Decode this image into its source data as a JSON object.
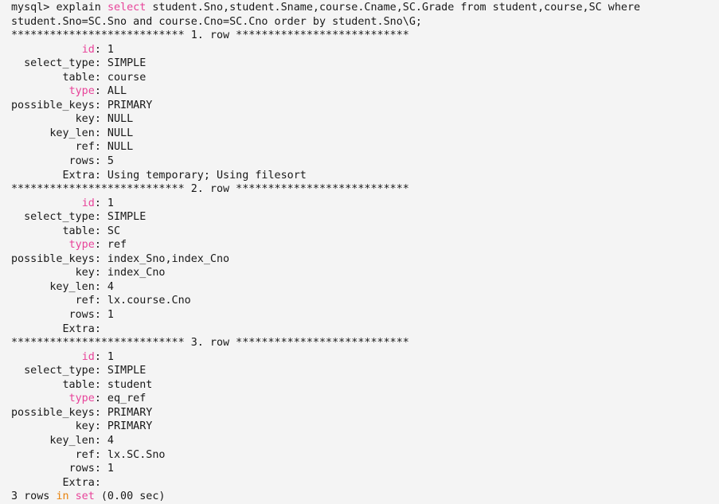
{
  "terminal": {
    "prompt": "mysql> ",
    "colors": {
      "background": "#f4f4f4",
      "foreground": "#181818",
      "keyword_pink": "#e8449a",
      "keyword_orange": "#e8820c"
    },
    "query": {
      "command": "explain ",
      "keyword_select": "select",
      "select_list": " student.Sno,student.Sname,course.Cname,SC.Grade from student,course,SC where",
      "continuation": "student.Sno=SC.Sno and course.Cno=SC.Cno order by student.Sno\\G;"
    },
    "separator": {
      "asterisks_left": "***************************",
      "asterisks_right": "***************************",
      "row_word": "row"
    },
    "rows": [
      {
        "index": "1.",
        "fields": [
          {
            "label": "id",
            "keyword": true,
            "value": "1"
          },
          {
            "label": "select_type",
            "keyword": false,
            "value": "SIMPLE"
          },
          {
            "label": "table",
            "keyword": false,
            "value": "course"
          },
          {
            "label": "type",
            "keyword": true,
            "value": "ALL"
          },
          {
            "label": "possible_keys",
            "keyword": false,
            "value": "PRIMARY"
          },
          {
            "label": "key",
            "keyword": false,
            "value": "NULL"
          },
          {
            "label": "key_len",
            "keyword": false,
            "value": "NULL"
          },
          {
            "label": "ref",
            "keyword": false,
            "value": "NULL"
          },
          {
            "label": "rows",
            "keyword": false,
            "value": "5"
          },
          {
            "label": "Extra",
            "keyword": false,
            "value": "Using temporary; Using filesort"
          }
        ]
      },
      {
        "index": "2.",
        "fields": [
          {
            "label": "id",
            "keyword": true,
            "value": "1"
          },
          {
            "label": "select_type",
            "keyword": false,
            "value": "SIMPLE"
          },
          {
            "label": "table",
            "keyword": false,
            "value": "SC"
          },
          {
            "label": "type",
            "keyword": true,
            "value": "ref"
          },
          {
            "label": "possible_keys",
            "keyword": false,
            "value": "index_Sno,index_Cno"
          },
          {
            "label": "key",
            "keyword": false,
            "value": "index_Cno"
          },
          {
            "label": "key_len",
            "keyword": false,
            "value": "4"
          },
          {
            "label": "ref",
            "keyword": false,
            "value": "lx.course.Cno"
          },
          {
            "label": "rows",
            "keyword": false,
            "value": "1"
          },
          {
            "label": "Extra",
            "keyword": false,
            "value": ""
          }
        ]
      },
      {
        "index": "3.",
        "fields": [
          {
            "label": "id",
            "keyword": true,
            "value": "1"
          },
          {
            "label": "select_type",
            "keyword": false,
            "value": "SIMPLE"
          },
          {
            "label": "table",
            "keyword": false,
            "value": "student"
          },
          {
            "label": "type",
            "keyword": true,
            "value": "eq_ref"
          },
          {
            "label": "possible_keys",
            "keyword": false,
            "value": "PRIMARY"
          },
          {
            "label": "key",
            "keyword": false,
            "value": "PRIMARY"
          },
          {
            "label": "key_len",
            "keyword": false,
            "value": "4"
          },
          {
            "label": "ref",
            "keyword": false,
            "value": "lx.SC.Sno"
          },
          {
            "label": "rows",
            "keyword": false,
            "value": "1"
          },
          {
            "label": "Extra",
            "keyword": false,
            "value": ""
          }
        ]
      }
    ],
    "footer": {
      "count": "3 rows ",
      "kw_in": "in",
      "space1": " ",
      "kw_set": "set",
      "timing": " (0.00 sec)"
    }
  }
}
